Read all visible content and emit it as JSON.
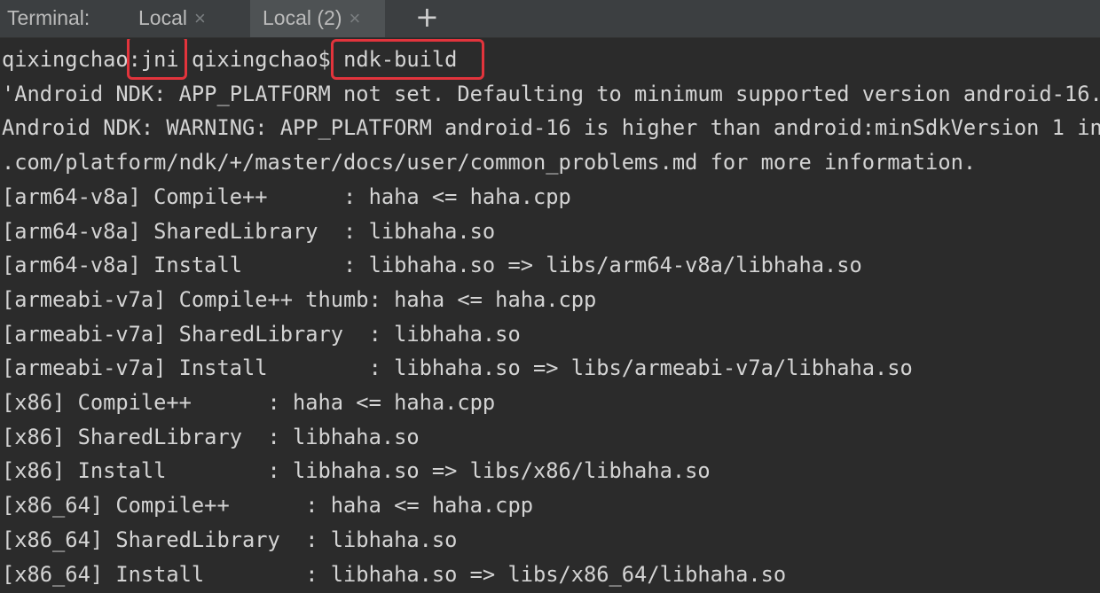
{
  "tabbar": {
    "label": "Terminal:",
    "tabs": [
      {
        "label": "Local",
        "close": "×"
      },
      {
        "label": "Local (2)",
        "close": "×"
      }
    ],
    "add": "+"
  },
  "terminal": {
    "prompt": {
      "user": "qixingchao",
      "sep": ":",
      "dir": "jni",
      "rest": " qixingchao$ ",
      "command": "ndk-build"
    },
    "lines": [
      "'Android NDK: APP_PLATFORM not set. Defaulting to minimum supported version android-16.",
      "Android NDK: WARNING: APP_PLATFORM android-16 is higher than android:minSdkVersion 1 in",
      ".com/platform/ndk/+/master/docs/user/common_problems.md for more information.",
      "[arm64-v8a] Compile++      : haha <= haha.cpp",
      "[arm64-v8a] SharedLibrary  : libhaha.so",
      "[arm64-v8a] Install        : libhaha.so => libs/arm64-v8a/libhaha.so",
      "[armeabi-v7a] Compile++ thumb: haha <= haha.cpp",
      "[armeabi-v7a] SharedLibrary  : libhaha.so",
      "[armeabi-v7a] Install        : libhaha.so => libs/armeabi-v7a/libhaha.so",
      "[x86] Compile++      : haha <= haha.cpp",
      "[x86] SharedLibrary  : libhaha.so",
      "[x86] Install        : libhaha.so => libs/x86/libhaha.so",
      "[x86_64] Compile++      : haha <= haha.cpp",
      "[x86_64] SharedLibrary  : libhaha.so",
      "[x86_64] Install        : libhaha.so => libs/x86_64/libhaha.so"
    ]
  },
  "colors": {
    "background": "#2b2b2b",
    "tabbar": "#3c3f41",
    "active_tab": "#4e5254",
    "text": "#d4d4d4",
    "highlight": "#e2343c"
  }
}
